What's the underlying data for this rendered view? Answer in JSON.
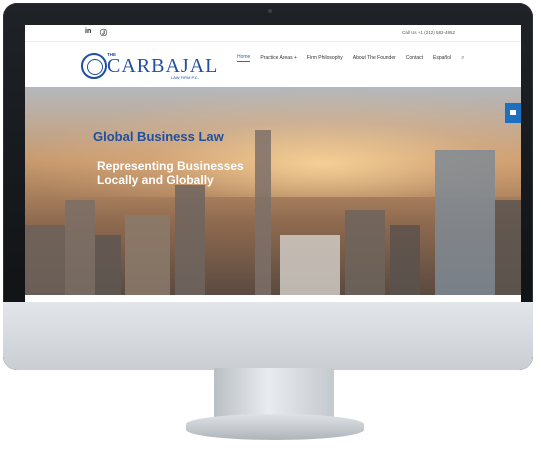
{
  "topbar": {
    "social": [
      "in",
      "Ⓙ"
    ],
    "call": "Call Us +1 (212) 582-4852"
  },
  "header": {
    "logo_the": "THE",
    "logo_name": "CARBAJAL",
    "logo_sub": "LAW FIRM P.C.",
    "nav": [
      "Home",
      "Practice Areas",
      "Firm Philosophy",
      "About The Founder",
      "Contact",
      "Español"
    ],
    "practice_caret": "+",
    "search_icon": "⌕"
  },
  "hero": {
    "title": "Global Business Law",
    "subtitle_line1": "Representing Businesses",
    "subtitle_line2": "Locally and Globally"
  },
  "colors": {
    "brand_blue": "#1f4fa0",
    "accent_blue": "#1f6fc0"
  }
}
